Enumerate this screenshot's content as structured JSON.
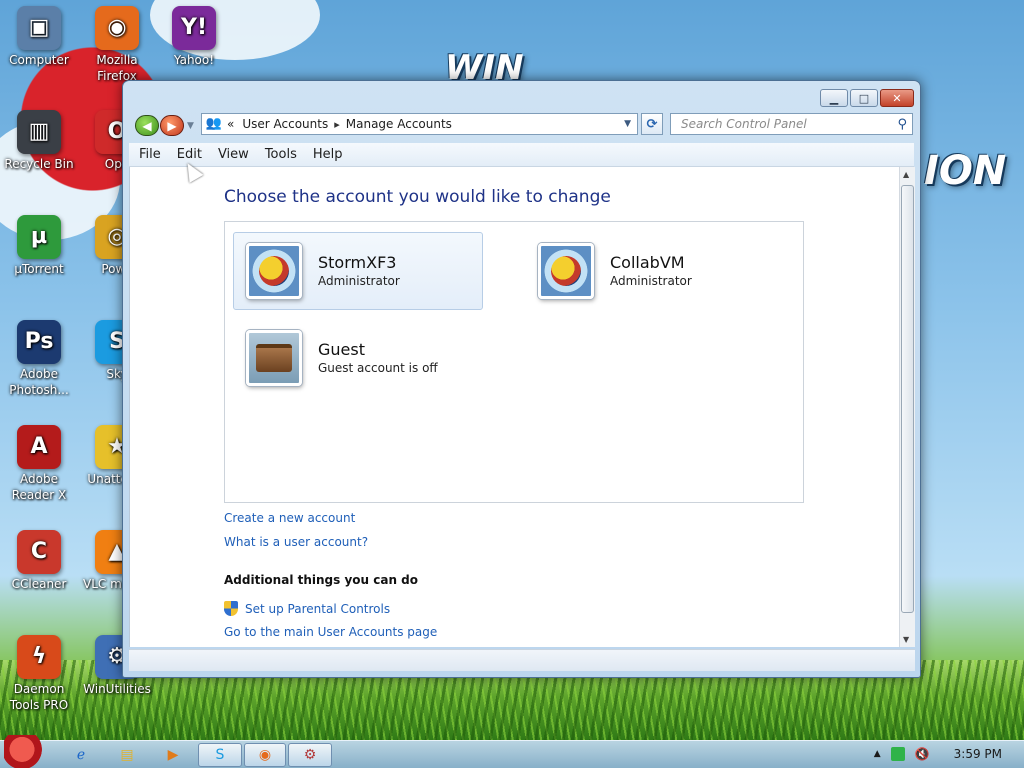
{
  "desktop": {
    "icons": [
      {
        "label": "Computer",
        "color": "#5b7fa8",
        "glyph": "▣"
      },
      {
        "label": "Mozilla Firefox",
        "color": "#e56a1c",
        "glyph": "◉"
      },
      {
        "label": "Yahoo!",
        "color": "#7b2a9a",
        "glyph": "Y!"
      },
      {
        "label": "Recycle Bin",
        "color": "#3a3f46",
        "glyph": "▥"
      },
      {
        "label": "Ope",
        "color": "#cf2a2a",
        "glyph": "O"
      },
      {
        "label": "µTorrent",
        "color": "#2e9a3c",
        "glyph": "µ"
      },
      {
        "label": "Powe",
        "color": "#d9a321",
        "glyph": "◎"
      },
      {
        "label": "Adobe Photosh...",
        "color": "#1c3a70",
        "glyph": "Ps"
      },
      {
        "label": "Sky",
        "color": "#1b9be0",
        "glyph": "S"
      },
      {
        "label": "Adobe Reader X",
        "color": "#b41b1b",
        "glyph": "A"
      },
      {
        "label": "Unatte So",
        "color": "#e6c02a",
        "glyph": "★"
      },
      {
        "label": "CCleaner",
        "color": "#c9382c",
        "glyph": "C"
      },
      {
        "label": "VLC m play",
        "color": "#f07f12",
        "glyph": "▲"
      },
      {
        "label": "Daemon Tools PRO",
        "color": "#d84a1a",
        "glyph": "ϟ"
      },
      {
        "label": "WinUtilities",
        "color": "#3f6fb5",
        "glyph": "⚙"
      }
    ],
    "background_text": "WIN ION"
  },
  "window": {
    "address": {
      "root_chevron": "«",
      "crumb1": "User Accounts",
      "sep": "▸",
      "crumb2": "Manage Accounts"
    },
    "search_placeholder": "Search Control Panel",
    "menu": [
      "File",
      "Edit",
      "View",
      "Tools",
      "Help"
    ],
    "page_title": "Choose the account you would like to change",
    "accounts": [
      {
        "name": "StormXF3",
        "role": "Administrator",
        "selected": true
      },
      {
        "name": "CollabVM",
        "role": "Administrator",
        "selected": false
      },
      {
        "name": "Guest",
        "role": "Guest account is off",
        "selected": false
      }
    ],
    "links": {
      "create_account": "Create a new account",
      "what_is": "What is a user account?"
    },
    "additional": {
      "heading": "Additional things you can do",
      "parental": "Set up Parental Controls",
      "main_page": "Go to the main User Accounts page"
    }
  },
  "taskbar": {
    "clock": "3:59 PM"
  },
  "colors": {
    "link": "#1f5fb8",
    "title": "#1e3287"
  }
}
